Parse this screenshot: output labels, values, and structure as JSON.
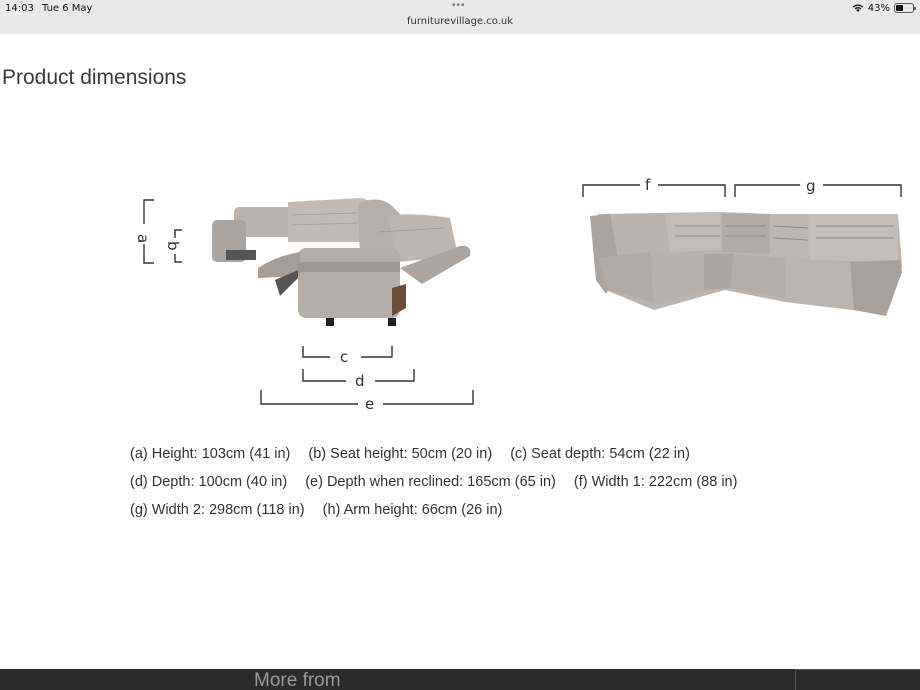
{
  "status_bar": {
    "time": "14:03",
    "date": "Tue 6 May",
    "url": "furniturevillage.co.uk",
    "battery": "43%",
    "battery_level": 0.43
  },
  "page": {
    "title": "Product dimensions",
    "diagram_labels": [
      "a",
      "b",
      "c",
      "d",
      "e",
      "f",
      "g"
    ],
    "dimensions": [
      [
        "(a) Height: 103cm (41 in)",
        "(b) Seat height: 50cm (20 in)",
        "(c) Seat depth: 54cm (22 in)"
      ],
      [
        "(d) Depth: 100cm (40 in)",
        "(e) Depth when reclined: 165cm (65 in)",
        "(f) Width 1: 222cm (88 in)"
      ],
      [
        "(g) Width 2: 298cm (118 in)",
        "(h) Arm height: 66cm (26 in)"
      ]
    ],
    "footer_text": "More from"
  },
  "colors": {
    "sofa_fill": "#b9b4b0",
    "sofa_dark": "#8f8a86",
    "status_bg": "#e9e9ea",
    "footer_bg": "#2b2b2b"
  }
}
